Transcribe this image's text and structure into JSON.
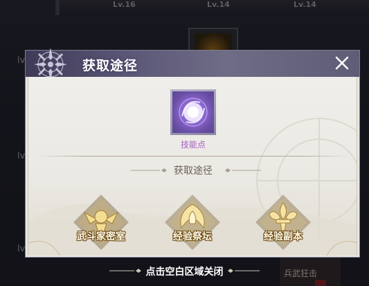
{
  "background": {
    "level_tags": [
      "Lv.16",
      "Lv.14",
      "Lv.14"
    ],
    "side_labels": [
      "lv",
      "lv",
      "lv"
    ],
    "bottom_item_text": "兵武狂击"
  },
  "popup": {
    "title": "获取途径",
    "item": {
      "name": "技能点",
      "icon": "skill-point-orb-icon"
    },
    "section_title": "获取途径",
    "sources": [
      {
        "label": "武斗家密室",
        "icon": "fighter-crest-icon"
      },
      {
        "label": "经验祭坛",
        "icon": "phoenix-wings-icon"
      },
      {
        "label": "经验副本",
        "icon": "fleur-de-lis-icon"
      }
    ]
  },
  "hint": "点击空白区域关闭",
  "colors": {
    "header": "#5a5676",
    "body": "#ebe9e4",
    "item_name": "#a560c2",
    "gold": "#d4a94a"
  }
}
